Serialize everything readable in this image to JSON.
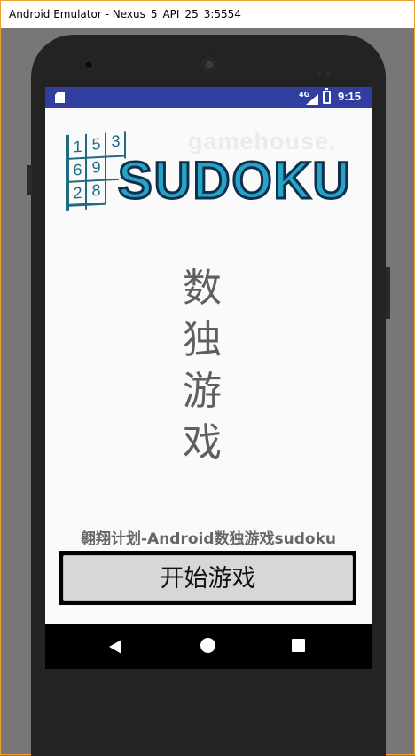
{
  "window": {
    "title": "Android Emulator - Nexus_5_API_25_3:5554"
  },
  "statusbar": {
    "network": "4G",
    "time": "9:15"
  },
  "logo": {
    "watermark": "gamehouse.",
    "word": "SUDOKU",
    "grid_digits": [
      "1",
      "5",
      "3",
      "6",
      "9",
      "",
      "2",
      "8",
      ""
    ]
  },
  "main": {
    "vertical_title": [
      "数",
      "独",
      "游",
      "戏"
    ],
    "subtitle": "翱翔计划-Android数独游戏sudoku",
    "start_button": "开始游戏"
  },
  "colors": {
    "statusbar": "#303f9f",
    "accent": "#27a3c4",
    "logo_dark": "#1c6c84",
    "button": "#d6d7d7"
  },
  "icons": {
    "back": "back-icon",
    "home": "home-icon",
    "recents": "recents-icon",
    "sd": "sd-card-icon",
    "battery": "battery-icon",
    "signal": "signal-icon"
  }
}
